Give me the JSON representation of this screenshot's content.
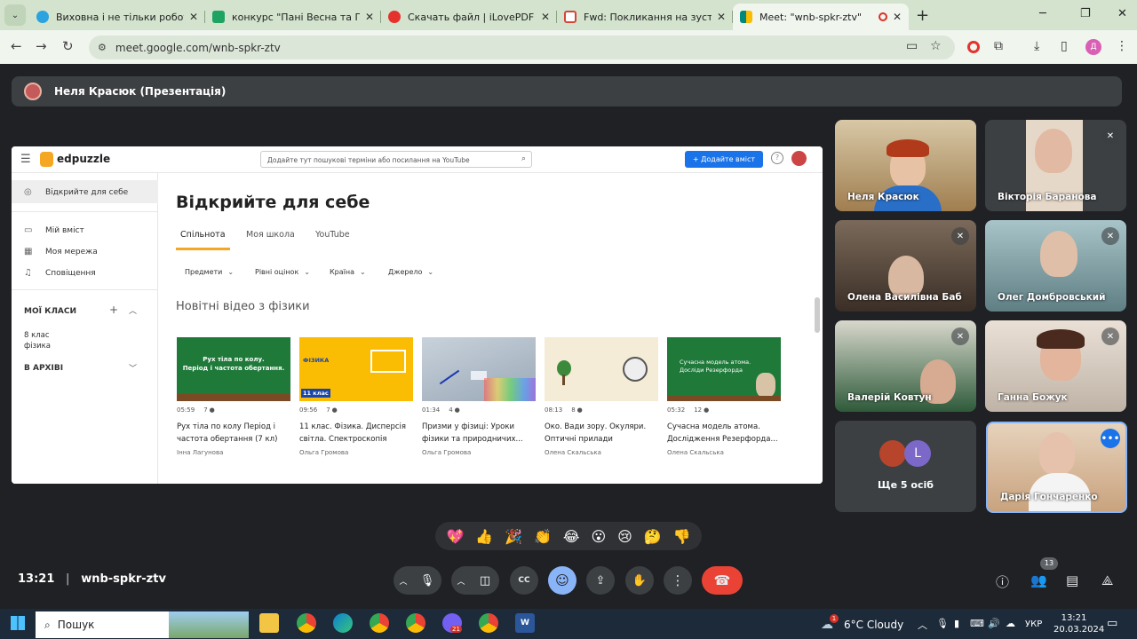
{
  "tabs": [
    {
      "title": "Виховна і не тільки робота 🙉",
      "color": "#2aa3de"
    },
    {
      "title": "конкурс \"Пані Весна та Пан Бе",
      "color": "#1ea362"
    },
    {
      "title": "Скачать файл | iLovePDF",
      "color": "#e5322d"
    },
    {
      "title": "Fwd: Покликання на зустріч - ",
      "color": "#d44638"
    },
    {
      "title": "Meet: \"wnb-spkr-ztv\"",
      "color": "#00897b"
    }
  ],
  "url": "meet.google.com/wnb-spkr-ztv",
  "presenter": "Неля Красюк (Презентація)",
  "edpuzzle": {
    "logo": "edpuzzle",
    "search_placeholder": "Додайте тут пошукові терміни або посилання на YouTube",
    "add_button": "+ Додайте вміст",
    "sidebar": {
      "discover": "Відкрийте для себе",
      "my_content": "Мій вміст",
      "my_network": "Моя мережа",
      "notifications": "Сповіщення",
      "my_classes": "МОЇ КЛАСИ",
      "class_name": "8 клас",
      "class_sub": "фізика",
      "archive": "В АРХІВІ"
    },
    "heading": "Відкрийте для себе",
    "tabs": [
      "Спільнота",
      "Моя школа",
      "YouTube"
    ],
    "filters": [
      "Предмети",
      "Рівні оцінок",
      "Країна",
      "Джерело"
    ],
    "section": "Новітні відео з фізики",
    "videos": [
      {
        "thumb_line1": "Рух тіла по колу.",
        "thumb_line2": "Період і частота обертання.",
        "duration": "05:59",
        "q": "7",
        "title": "Рух тіла по колу Період і частота обертання (7 кл)",
        "author": "Інна Лагунова"
      },
      {
        "thumb_line1": "ФІЗИКА",
        "thumb_line2": "11 клас",
        "duration": "09:56",
        "q": "7",
        "title": "11 клас. Фізика. Дисперсія світла. Спектроскопія",
        "author": "Ольга Громова"
      },
      {
        "thumb_line1": "",
        "thumb_line2": "",
        "duration": "01:34",
        "q": "4",
        "title": "Призми у фізиці: Уроки фізики та природничих...",
        "author": "Ольга Громова"
      },
      {
        "thumb_line1": "",
        "thumb_line2": "",
        "duration": "08:13",
        "q": "8",
        "title": "Око. Вади зору. Окуляри. Оптичні прилади",
        "author": "Олена Скальська"
      },
      {
        "thumb_line1": "Сучасна модель атома.",
        "thumb_line2": "Досліди Резерфорда",
        "duration": "05:32",
        "q": "12",
        "title": "Сучасна модель атома. Дослідження Резерфорда...",
        "author": "Олена Скальська"
      }
    ]
  },
  "participants": [
    {
      "name": "Неля Красюк"
    },
    {
      "name": "Вікторія Баранова"
    },
    {
      "name": "Олена Василівна Баб"
    },
    {
      "name": "Олег Домбровський"
    },
    {
      "name": "Валерій Ковтун"
    },
    {
      "name": "Ганна Божук"
    },
    {
      "name": "Ще 5 осіб",
      "avatar_letter": "L"
    },
    {
      "name": "Дарія Гончаренко"
    }
  ],
  "reactions": [
    "💖",
    "👍",
    "🎉",
    "👏",
    "😂",
    "😮",
    "😢",
    "🤔",
    "👎"
  ],
  "meeting": {
    "time": "13:21",
    "code": "wnb-spkr-ztv",
    "people_count": "13"
  },
  "taskbar": {
    "search": "Пошук",
    "weather": "6°C  Cloudy",
    "lang": "УКР",
    "time": "13:21",
    "date": "20.03.2024",
    "weather_badge": "1",
    "app_badge": "21"
  }
}
